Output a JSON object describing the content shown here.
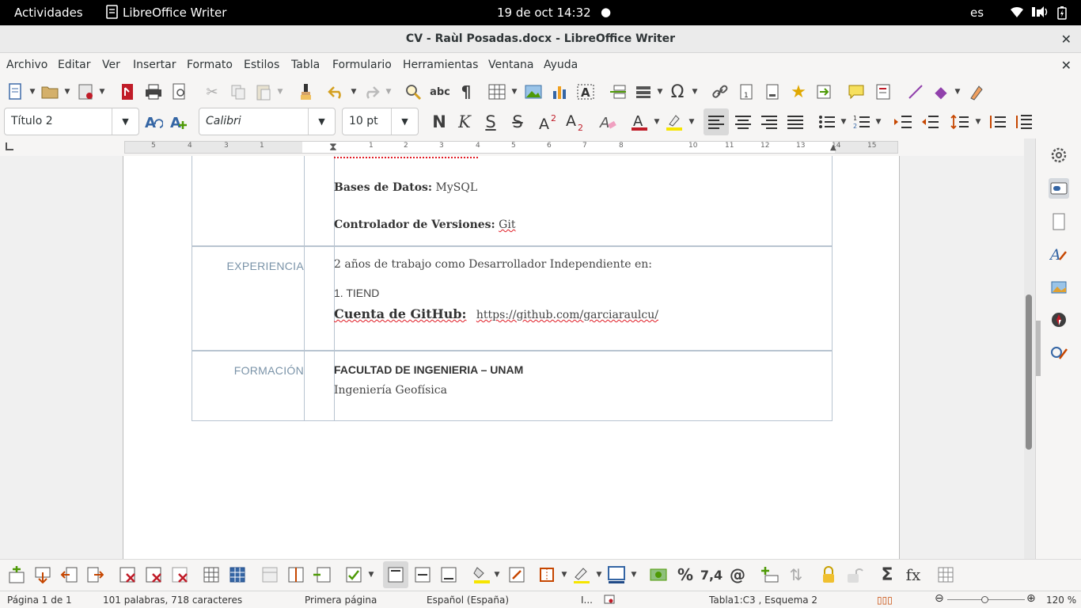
{
  "topbar": {
    "activities": "Actividades",
    "app_name": "LibreOffice Writer",
    "datetime": "19 de oct  14:32",
    "language": "es"
  },
  "window": {
    "title": "CV - Raùl Posadas.docx - LibreOffice Writer"
  },
  "menu": {
    "items": [
      "Archivo",
      "Editar",
      "Ver",
      "Insertar",
      "Formato",
      "Estilos",
      "Tabla",
      "Formulario",
      "Herramientas",
      "Ventana",
      "Ayuda"
    ]
  },
  "format_bar": {
    "paragraph_style": "Título 2",
    "font_name": "Calibri",
    "font_size": "10 pt",
    "bold_glyph": "N",
    "italic_glyph": "K",
    "underline_glyph": "S",
    "strike_glyph": "S"
  },
  "ruler": {
    "labels": [
      "5",
      "4",
      "3",
      "1",
      "1",
      "2",
      "3",
      "4",
      "5",
      "6",
      "7",
      "8",
      "10",
      "11",
      "12",
      "13",
      "14",
      "15"
    ]
  },
  "document": {
    "skills": {
      "db_label": "Bases de Datos:",
      "db_value": " MySQL",
      "vcs_label": "Controlador de Versiones:",
      "vcs_value": "Git"
    },
    "experience": {
      "section": "EXPERIENCIA",
      "summary": "2  años de trabajo como Desarrollador Independiente en:",
      "item1": "1. TIEND",
      "github_label": "Cuenta de GitHub:",
      "github_url": "https://github.com/garciaraulcu/"
    },
    "education": {
      "section": "FORMACIÓN",
      "school": "FACULTAD DE INGENIERIA – UNAM",
      "degree": "Ingeniería Geofísica"
    }
  },
  "statusbar": {
    "page": "Página 1 de 1",
    "words": "101 palabras, 718 caracteres",
    "page_style": "Primera página",
    "language": "Español (España)",
    "table_info": "Tabla1:C3 , Esquema 2",
    "zoom": "120 %"
  },
  "bottom_toolbar": {
    "percent": "%",
    "number_format": "7,4",
    "sum": "Σ",
    "formula": "fx"
  }
}
